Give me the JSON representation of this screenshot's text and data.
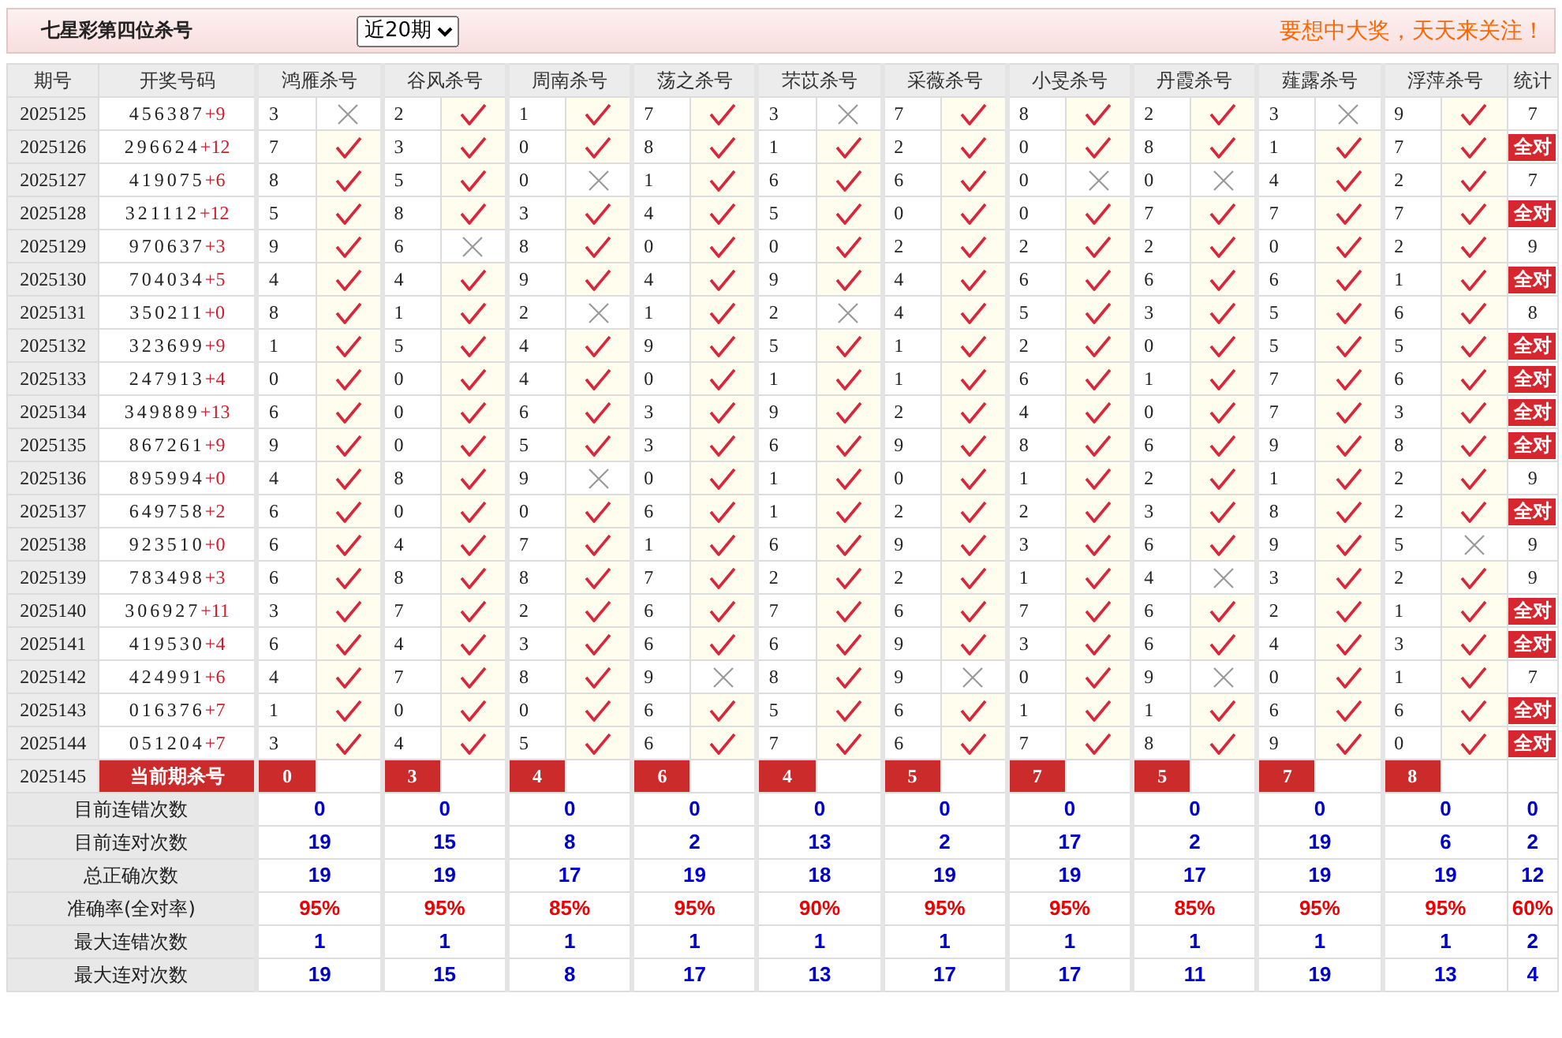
{
  "header": {
    "title": "七星彩第四位杀号",
    "period_select": {
      "value": "近20期"
    },
    "slogan": "要想中大奖，天天来关注！"
  },
  "table": {
    "columns": [
      {
        "label": "期号",
        "kind": "plain"
      },
      {
        "label": "开奖号码",
        "kind": "plain"
      },
      {
        "label": "鸿雁杀号",
        "kind": "predictor"
      },
      {
        "label": "谷风杀号",
        "kind": "predictor"
      },
      {
        "label": "周南杀号",
        "kind": "predictor"
      },
      {
        "label": "荡之杀号",
        "kind": "predictor"
      },
      {
        "label": "芣苡杀号",
        "kind": "predictor"
      },
      {
        "label": "采薇杀号",
        "kind": "predictor"
      },
      {
        "label": "小旻杀号",
        "kind": "predictor"
      },
      {
        "label": "丹霞杀号",
        "kind": "predictor"
      },
      {
        "label": "薤露杀号",
        "kind": "predictor"
      },
      {
        "label": "浮萍杀号",
        "kind": "predictor"
      },
      {
        "label": "统计",
        "kind": "stat"
      }
    ],
    "rows": [
      {
        "issue": "2025125",
        "draw": "456387",
        "bonus": "+9",
        "picks": [
          {
            "number": "3",
            "hit": false
          },
          {
            "number": "2",
            "hit": true
          },
          {
            "number": "1",
            "hit": true
          },
          {
            "number": "7",
            "hit": true
          },
          {
            "number": "3",
            "hit": false
          },
          {
            "number": "7",
            "hit": true
          },
          {
            "number": "8",
            "hit": true
          },
          {
            "number": "2",
            "hit": true
          },
          {
            "number": "3",
            "hit": false
          },
          {
            "number": "9",
            "hit": true
          }
        ],
        "stat": {
          "kind": "count",
          "text": "7"
        }
      },
      {
        "issue": "2025126",
        "draw": "296624",
        "bonus": "+12",
        "picks": [
          {
            "number": "7",
            "hit": true
          },
          {
            "number": "3",
            "hit": true
          },
          {
            "number": "0",
            "hit": true
          },
          {
            "number": "8",
            "hit": true
          },
          {
            "number": "1",
            "hit": true
          },
          {
            "number": "2",
            "hit": true
          },
          {
            "number": "0",
            "hit": true
          },
          {
            "number": "8",
            "hit": true
          },
          {
            "number": "1",
            "hit": true
          },
          {
            "number": "7",
            "hit": true
          }
        ],
        "stat": {
          "kind": "all_correct",
          "text": "全对"
        }
      },
      {
        "issue": "2025127",
        "draw": "419075",
        "bonus": "+6",
        "picks": [
          {
            "number": "8",
            "hit": true
          },
          {
            "number": "5",
            "hit": true
          },
          {
            "number": "0",
            "hit": false
          },
          {
            "number": "1",
            "hit": true
          },
          {
            "number": "6",
            "hit": true
          },
          {
            "number": "6",
            "hit": true
          },
          {
            "number": "0",
            "hit": false
          },
          {
            "number": "0",
            "hit": false
          },
          {
            "number": "4",
            "hit": true
          },
          {
            "number": "2",
            "hit": true
          }
        ],
        "stat": {
          "kind": "count",
          "text": "7"
        }
      },
      {
        "issue": "2025128",
        "draw": "321112",
        "bonus": "+12",
        "picks": [
          {
            "number": "5",
            "hit": true
          },
          {
            "number": "8",
            "hit": true
          },
          {
            "number": "3",
            "hit": true
          },
          {
            "number": "4",
            "hit": true
          },
          {
            "number": "5",
            "hit": true
          },
          {
            "number": "0",
            "hit": true
          },
          {
            "number": "0",
            "hit": true
          },
          {
            "number": "7",
            "hit": true
          },
          {
            "number": "7",
            "hit": true
          },
          {
            "number": "7",
            "hit": true
          }
        ],
        "stat": {
          "kind": "all_correct",
          "text": "全对"
        }
      },
      {
        "issue": "2025129",
        "draw": "970637",
        "bonus": "+3",
        "picks": [
          {
            "number": "9",
            "hit": true
          },
          {
            "number": "6",
            "hit": false
          },
          {
            "number": "8",
            "hit": true
          },
          {
            "number": "0",
            "hit": true
          },
          {
            "number": "0",
            "hit": true
          },
          {
            "number": "2",
            "hit": true
          },
          {
            "number": "2",
            "hit": true
          },
          {
            "number": "2",
            "hit": true
          },
          {
            "number": "0",
            "hit": true
          },
          {
            "number": "2",
            "hit": true
          }
        ],
        "stat": {
          "kind": "count",
          "text": "9"
        }
      },
      {
        "issue": "2025130",
        "draw": "704034",
        "bonus": "+5",
        "picks": [
          {
            "number": "4",
            "hit": true
          },
          {
            "number": "4",
            "hit": true
          },
          {
            "number": "9",
            "hit": true
          },
          {
            "number": "4",
            "hit": true
          },
          {
            "number": "9",
            "hit": true
          },
          {
            "number": "4",
            "hit": true
          },
          {
            "number": "6",
            "hit": true
          },
          {
            "number": "6",
            "hit": true
          },
          {
            "number": "6",
            "hit": true
          },
          {
            "number": "1",
            "hit": true
          }
        ],
        "stat": {
          "kind": "all_correct",
          "text": "全对"
        }
      },
      {
        "issue": "2025131",
        "draw": "350211",
        "bonus": "+0",
        "picks": [
          {
            "number": "8",
            "hit": true
          },
          {
            "number": "1",
            "hit": true
          },
          {
            "number": "2",
            "hit": false
          },
          {
            "number": "1",
            "hit": true
          },
          {
            "number": "2",
            "hit": false
          },
          {
            "number": "4",
            "hit": true
          },
          {
            "number": "5",
            "hit": true
          },
          {
            "number": "3",
            "hit": true
          },
          {
            "number": "5",
            "hit": true
          },
          {
            "number": "6",
            "hit": true
          }
        ],
        "stat": {
          "kind": "count",
          "text": "8"
        }
      },
      {
        "issue": "2025132",
        "draw": "323699",
        "bonus": "+9",
        "picks": [
          {
            "number": "1",
            "hit": true
          },
          {
            "number": "5",
            "hit": true
          },
          {
            "number": "4",
            "hit": true
          },
          {
            "number": "9",
            "hit": true
          },
          {
            "number": "5",
            "hit": true
          },
          {
            "number": "1",
            "hit": true
          },
          {
            "number": "2",
            "hit": true
          },
          {
            "number": "0",
            "hit": true
          },
          {
            "number": "5",
            "hit": true
          },
          {
            "number": "5",
            "hit": true
          }
        ],
        "stat": {
          "kind": "all_correct",
          "text": "全对"
        }
      },
      {
        "issue": "2025133",
        "draw": "247913",
        "bonus": "+4",
        "picks": [
          {
            "number": "0",
            "hit": true
          },
          {
            "number": "0",
            "hit": true
          },
          {
            "number": "4",
            "hit": true
          },
          {
            "number": "0",
            "hit": true
          },
          {
            "number": "1",
            "hit": true
          },
          {
            "number": "1",
            "hit": true
          },
          {
            "number": "6",
            "hit": true
          },
          {
            "number": "1",
            "hit": true
          },
          {
            "number": "7",
            "hit": true
          },
          {
            "number": "6",
            "hit": true
          }
        ],
        "stat": {
          "kind": "all_correct",
          "text": "全对"
        }
      },
      {
        "issue": "2025134",
        "draw": "349889",
        "bonus": "+13",
        "picks": [
          {
            "number": "6",
            "hit": true
          },
          {
            "number": "0",
            "hit": true
          },
          {
            "number": "6",
            "hit": true
          },
          {
            "number": "3",
            "hit": true
          },
          {
            "number": "9",
            "hit": true
          },
          {
            "number": "2",
            "hit": true
          },
          {
            "number": "4",
            "hit": true
          },
          {
            "number": "0",
            "hit": true
          },
          {
            "number": "7",
            "hit": true
          },
          {
            "number": "3",
            "hit": true
          }
        ],
        "stat": {
          "kind": "all_correct",
          "text": "全对"
        }
      },
      {
        "issue": "2025135",
        "draw": "867261",
        "bonus": "+9",
        "picks": [
          {
            "number": "9",
            "hit": true
          },
          {
            "number": "0",
            "hit": true
          },
          {
            "number": "5",
            "hit": true
          },
          {
            "number": "3",
            "hit": true
          },
          {
            "number": "6",
            "hit": true
          },
          {
            "number": "9",
            "hit": true
          },
          {
            "number": "8",
            "hit": true
          },
          {
            "number": "6",
            "hit": true
          },
          {
            "number": "9",
            "hit": true
          },
          {
            "number": "8",
            "hit": true
          }
        ],
        "stat": {
          "kind": "all_correct",
          "text": "全对"
        }
      },
      {
        "issue": "2025136",
        "draw": "895994",
        "bonus": "+0",
        "picks": [
          {
            "number": "4",
            "hit": true
          },
          {
            "number": "8",
            "hit": true
          },
          {
            "number": "9",
            "hit": false
          },
          {
            "number": "0",
            "hit": true
          },
          {
            "number": "1",
            "hit": true
          },
          {
            "number": "0",
            "hit": true
          },
          {
            "number": "1",
            "hit": true
          },
          {
            "number": "2",
            "hit": true
          },
          {
            "number": "1",
            "hit": true
          },
          {
            "number": "2",
            "hit": true
          }
        ],
        "stat": {
          "kind": "count",
          "text": "9"
        }
      },
      {
        "issue": "2025137",
        "draw": "649758",
        "bonus": "+2",
        "picks": [
          {
            "number": "6",
            "hit": true
          },
          {
            "number": "0",
            "hit": true
          },
          {
            "number": "0",
            "hit": true
          },
          {
            "number": "6",
            "hit": true
          },
          {
            "number": "1",
            "hit": true
          },
          {
            "number": "2",
            "hit": true
          },
          {
            "number": "2",
            "hit": true
          },
          {
            "number": "3",
            "hit": true
          },
          {
            "number": "8",
            "hit": true
          },
          {
            "number": "2",
            "hit": true
          }
        ],
        "stat": {
          "kind": "all_correct",
          "text": "全对"
        }
      },
      {
        "issue": "2025138",
        "draw": "923510",
        "bonus": "+0",
        "picks": [
          {
            "number": "6",
            "hit": true
          },
          {
            "number": "4",
            "hit": true
          },
          {
            "number": "7",
            "hit": true
          },
          {
            "number": "1",
            "hit": true
          },
          {
            "number": "6",
            "hit": true
          },
          {
            "number": "9",
            "hit": true
          },
          {
            "number": "3",
            "hit": true
          },
          {
            "number": "6",
            "hit": true
          },
          {
            "number": "9",
            "hit": true
          },
          {
            "number": "5",
            "hit": false
          }
        ],
        "stat": {
          "kind": "count",
          "text": "9"
        }
      },
      {
        "issue": "2025139",
        "draw": "783498",
        "bonus": "+3",
        "picks": [
          {
            "number": "6",
            "hit": true
          },
          {
            "number": "8",
            "hit": true
          },
          {
            "number": "8",
            "hit": true
          },
          {
            "number": "7",
            "hit": true
          },
          {
            "number": "2",
            "hit": true
          },
          {
            "number": "2",
            "hit": true
          },
          {
            "number": "1",
            "hit": true
          },
          {
            "number": "4",
            "hit": false
          },
          {
            "number": "3",
            "hit": true
          },
          {
            "number": "2",
            "hit": true
          }
        ],
        "stat": {
          "kind": "count",
          "text": "9"
        }
      },
      {
        "issue": "2025140",
        "draw": "306927",
        "bonus": "+11",
        "picks": [
          {
            "number": "3",
            "hit": true
          },
          {
            "number": "7",
            "hit": true
          },
          {
            "number": "2",
            "hit": true
          },
          {
            "number": "6",
            "hit": true
          },
          {
            "number": "7",
            "hit": true
          },
          {
            "number": "6",
            "hit": true
          },
          {
            "number": "7",
            "hit": true
          },
          {
            "number": "6",
            "hit": true
          },
          {
            "number": "2",
            "hit": true
          },
          {
            "number": "1",
            "hit": true
          }
        ],
        "stat": {
          "kind": "all_correct",
          "text": "全对"
        }
      },
      {
        "issue": "2025141",
        "draw": "419530",
        "bonus": "+4",
        "picks": [
          {
            "number": "6",
            "hit": true
          },
          {
            "number": "4",
            "hit": true
          },
          {
            "number": "3",
            "hit": true
          },
          {
            "number": "6",
            "hit": true
          },
          {
            "number": "6",
            "hit": true
          },
          {
            "number": "9",
            "hit": true
          },
          {
            "number": "3",
            "hit": true
          },
          {
            "number": "6",
            "hit": true
          },
          {
            "number": "4",
            "hit": true
          },
          {
            "number": "3",
            "hit": true
          }
        ],
        "stat": {
          "kind": "all_correct",
          "text": "全对"
        }
      },
      {
        "issue": "2025142",
        "draw": "424991",
        "bonus": "+6",
        "picks": [
          {
            "number": "4",
            "hit": true
          },
          {
            "number": "7",
            "hit": true
          },
          {
            "number": "8",
            "hit": true
          },
          {
            "number": "9",
            "hit": false
          },
          {
            "number": "8",
            "hit": true
          },
          {
            "number": "9",
            "hit": false
          },
          {
            "number": "0",
            "hit": true
          },
          {
            "number": "9",
            "hit": false
          },
          {
            "number": "0",
            "hit": true
          },
          {
            "number": "1",
            "hit": true
          }
        ],
        "stat": {
          "kind": "count",
          "text": "7"
        }
      },
      {
        "issue": "2025143",
        "draw": "016376",
        "bonus": "+7",
        "picks": [
          {
            "number": "1",
            "hit": true
          },
          {
            "number": "0",
            "hit": true
          },
          {
            "number": "0",
            "hit": true
          },
          {
            "number": "6",
            "hit": true
          },
          {
            "number": "5",
            "hit": true
          },
          {
            "number": "6",
            "hit": true
          },
          {
            "number": "1",
            "hit": true
          },
          {
            "number": "1",
            "hit": true
          },
          {
            "number": "6",
            "hit": true
          },
          {
            "number": "6",
            "hit": true
          }
        ],
        "stat": {
          "kind": "all_correct",
          "text": "全对"
        }
      },
      {
        "issue": "2025144",
        "draw": "051204",
        "bonus": "+7",
        "picks": [
          {
            "number": "3",
            "hit": true
          },
          {
            "number": "4",
            "hit": true
          },
          {
            "number": "5",
            "hit": true
          },
          {
            "number": "6",
            "hit": true
          },
          {
            "number": "7",
            "hit": true
          },
          {
            "number": "6",
            "hit": true
          },
          {
            "number": "7",
            "hit": true
          },
          {
            "number": "8",
            "hit": true
          },
          {
            "number": "9",
            "hit": true
          },
          {
            "number": "0",
            "hit": true
          }
        ],
        "stat": {
          "kind": "all_correct",
          "text": "全对"
        }
      }
    ],
    "current": {
      "issue": "2025145",
      "label": "当前期杀号",
      "picks": [
        "0",
        "3",
        "4",
        "6",
        "4",
        "5",
        "7",
        "5",
        "7",
        "8"
      ]
    },
    "summary": [
      {
        "label": "目前连错次数",
        "kind": "count",
        "values": [
          "0",
          "0",
          "0",
          "0",
          "0",
          "0",
          "0",
          "0",
          "0",
          "0",
          "0"
        ]
      },
      {
        "label": "目前连对次数",
        "kind": "count",
        "values": [
          "19",
          "15",
          "8",
          "2",
          "13",
          "2",
          "17",
          "2",
          "19",
          "6",
          "2"
        ]
      },
      {
        "label": "总正确次数",
        "kind": "count",
        "values": [
          "19",
          "19",
          "17",
          "19",
          "18",
          "19",
          "19",
          "17",
          "19",
          "19",
          "12"
        ]
      },
      {
        "label": "准确率(全对率)",
        "kind": "percent",
        "values": [
          "95%",
          "95%",
          "85%",
          "95%",
          "90%",
          "95%",
          "95%",
          "85%",
          "95%",
          "95%",
          "60%"
        ]
      },
      {
        "label": "最大连错次数",
        "kind": "count",
        "values": [
          "1",
          "1",
          "1",
          "1",
          "1",
          "1",
          "1",
          "1",
          "1",
          "1",
          "2"
        ]
      },
      {
        "label": "最大连对次数",
        "kind": "count",
        "values": [
          "19",
          "15",
          "8",
          "17",
          "13",
          "17",
          "17",
          "11",
          "19",
          "13",
          "4"
        ]
      }
    ]
  }
}
